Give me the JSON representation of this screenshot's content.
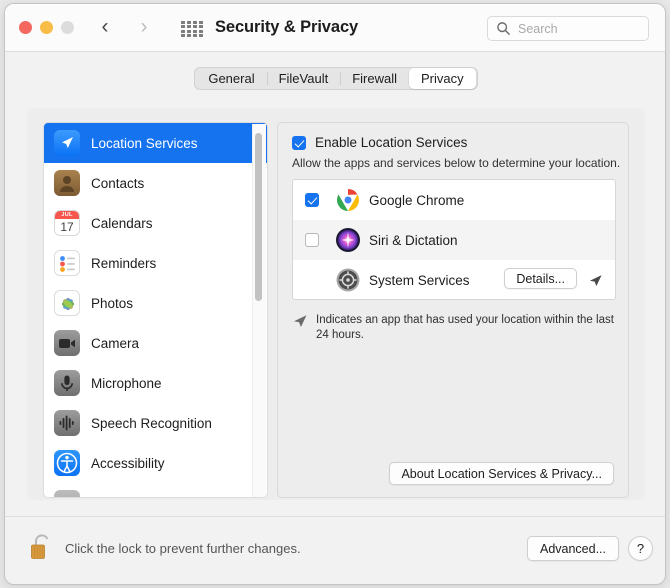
{
  "window": {
    "title": "Security & Privacy",
    "traffic_lights": [
      "close",
      "minimize",
      "zoom"
    ],
    "nav_back_icon": "chevron-left-icon",
    "nav_forward_icon": "chevron-right-icon",
    "grid_icon": "grid-view-icon"
  },
  "search": {
    "placeholder": "Search",
    "value": "",
    "icon": "search-icon"
  },
  "tabs": [
    {
      "label": "General",
      "selected": false
    },
    {
      "label": "FileVault",
      "selected": false
    },
    {
      "label": "Firewall",
      "selected": false
    },
    {
      "label": "Privacy",
      "selected": true
    }
  ],
  "sidebar": {
    "items": [
      {
        "label": "Location Services",
        "icon": "location-services-icon",
        "selected": true
      },
      {
        "label": "Contacts",
        "icon": "contacts-icon",
        "selected": false
      },
      {
        "label": "Calendars",
        "icon": "calendars-icon",
        "selected": false
      },
      {
        "label": "Reminders",
        "icon": "reminders-icon",
        "selected": false
      },
      {
        "label": "Photos",
        "icon": "photos-icon",
        "selected": false
      },
      {
        "label": "Camera",
        "icon": "camera-icon",
        "selected": false
      },
      {
        "label": "Microphone",
        "icon": "microphone-icon",
        "selected": false
      },
      {
        "label": "Speech Recognition",
        "icon": "speech-recognition-icon",
        "selected": false
      },
      {
        "label": "Accessibility",
        "icon": "accessibility-icon",
        "selected": false
      }
    ],
    "calendar_icon": {
      "month": "JUL",
      "day": "17"
    }
  },
  "privacy": {
    "enable_label": "Enable Location Services",
    "enable_checked": true,
    "description": "Allow the apps and services below to determine your location.",
    "apps": [
      {
        "name": "Google Chrome",
        "checked": true,
        "has_checkbox": true,
        "icon": "google-chrome-icon",
        "details_button": null,
        "used_location": false
      },
      {
        "name": "Siri & Dictation",
        "checked": false,
        "has_checkbox": true,
        "icon": "siri-icon",
        "details_button": null,
        "used_location": false
      },
      {
        "name": "System Services",
        "checked": false,
        "has_checkbox": false,
        "icon": "system-services-icon",
        "details_button": "Details...",
        "used_location": true
      }
    ],
    "legend_icon": "location-arrow-icon",
    "legend_text": "Indicates an app that has used your location within the last 24 hours.",
    "about_button": "About Location Services & Privacy..."
  },
  "footer": {
    "lock_icon": "unlocked-padlock-icon",
    "lock_text": "Click the lock to prevent further changes.",
    "advanced_button": "Advanced...",
    "help_button": "?"
  },
  "colors": {
    "accent": "#1573f0",
    "window_bg": "#f2f2f2",
    "panel_bg": "#ededed"
  }
}
